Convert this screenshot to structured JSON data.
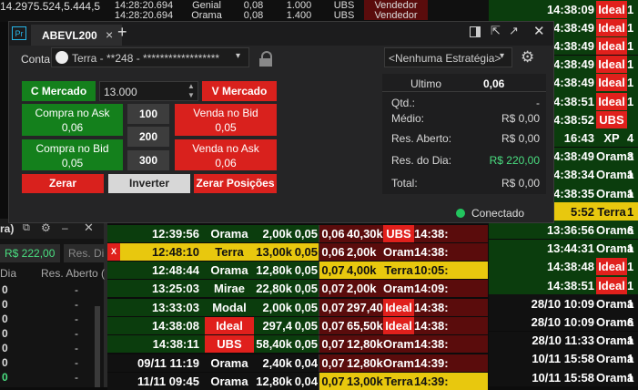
{
  "background": {
    "ticker_line": "14.2975.524,5.444,5",
    "top_trades": [
      {
        "time": "14:28:20.694",
        "buyer": "Genial",
        "price": "0,08",
        "qty": "1.000",
        "seller": "UBS",
        "side": "Vendedor"
      },
      {
        "time": "14:28:20.694",
        "buyer": "Orama",
        "price": "0,08",
        "qty": "1.400",
        "seller": "UBS",
        "side": "Vendedor"
      }
    ],
    "right_ladder": [
      {
        "time": "14:38:09",
        "broker": "Ideal",
        "extra": "1",
        "row": "green",
        "badge": "red"
      },
      {
        "time": "14:38:49",
        "broker": "Ideal",
        "extra": "1",
        "row": "green",
        "badge": "red"
      },
      {
        "time": "14:38:49",
        "broker": "Ideal",
        "extra": "1",
        "row": "green",
        "badge": "red"
      },
      {
        "time": "14:38:49",
        "broker": "Ideal",
        "extra": "1",
        "row": "green",
        "badge": "red"
      },
      {
        "time": "14:38:49",
        "broker": "Ideal",
        "extra": "1",
        "row": "green",
        "badge": "red"
      },
      {
        "time": "14:38:51",
        "broker": "Ideal",
        "extra": "1",
        "row": "green",
        "badge": "red"
      },
      {
        "time": "14:38:52",
        "broker": "UBS",
        "extra": "",
        "row": "green",
        "badge": "red"
      },
      {
        "time": "16:43",
        "broker": "XP",
        "extra": "4",
        "row": "green",
        "badge": "none"
      },
      {
        "time": "14:38:49",
        "broker": "Orama",
        "extra": "3",
        "row": "green",
        "badge": "none"
      },
      {
        "time": "14:38:34",
        "broker": "Orama",
        "extra": "1",
        "row": "green",
        "badge": "none"
      },
      {
        "time": "14:38:35",
        "broker": "Orama",
        "extra": "1",
        "row": "green",
        "badge": "none"
      },
      {
        "time": "5:52",
        "broker": "Terra",
        "extra": "1",
        "row": "yellow",
        "badge": "none"
      },
      {
        "time": "13:36:56",
        "broker": "Orama",
        "extra": "6",
        "row": "green",
        "badge": "none"
      },
      {
        "time": "13:44:31",
        "broker": "Orama",
        "extra": "1",
        "row": "green",
        "badge": "none"
      },
      {
        "time": "14:38:48",
        "broker": "Ideal",
        "extra": "1",
        "row": "green",
        "badge": "red"
      },
      {
        "time": "14:38:51",
        "broker": "Ideal",
        "extra": "1",
        "row": "green",
        "badge": "red"
      },
      {
        "time": "28/10 10:09",
        "broker": "Orama",
        "extra": "1",
        "row": "black",
        "badge": "none"
      },
      {
        "time": "28/10 10:09",
        "broker": "Orama",
        "extra": "6",
        "row": "black",
        "badge": "none"
      },
      {
        "time": "28/10 11:33",
        "broker": "Orama",
        "extra": "1",
        "row": "black",
        "badge": "none"
      },
      {
        "time": "10/11 15:58",
        "broker": "Orama",
        "extra": "1",
        "row": "black",
        "badge": "none"
      },
      {
        "time": "10/11 15:58",
        "broker": "Orama",
        "extra": "1",
        "row": "black",
        "badge": "none"
      }
    ],
    "bottom_rows": [
      {
        "x": "",
        "time": "12:39:56",
        "broker": "Orama",
        "qty": "2,00k",
        "p1": "0,05",
        "p2": "0,06",
        "q2": "40,30k",
        "b2": "UBS",
        "t2": "14:38:",
        "left": "green",
        "right": "darkred",
        "badge": "red"
      },
      {
        "x": "X",
        "time": "12:48:10",
        "broker": "Terra",
        "qty": "13,00k",
        "p1": "0,05",
        "p2": "0,06",
        "q2": "2,00k",
        "b2": "Orama",
        "t2": "14:38:",
        "left": "yellow",
        "right": "darkred",
        "badge": "none"
      },
      {
        "x": "",
        "time": "12:48:44",
        "broker": "Orama",
        "qty": "12,80k",
        "p1": "0,05",
        "p2": "0,07",
        "q2": "4,00k",
        "b2": "Terra",
        "t2": "10:05:",
        "left": "green",
        "right": "yellow",
        "badge": "none"
      },
      {
        "x": "",
        "time": "13:25:03",
        "broker": "Mirae",
        "qty": "22,80k",
        "p1": "0,05",
        "p2": "0,07",
        "q2": "2,00k",
        "b2": "Orama",
        "t2": "14:09:",
        "left": "green",
        "right": "darkred",
        "badge": "none"
      },
      {
        "x": "",
        "time": "13:33:03",
        "broker": "Modal",
        "qty": "2,00k",
        "p1": "0,05",
        "p2": "0,07",
        "q2": "297,40",
        "b2": "Ideal",
        "t2": "14:38:",
        "left": "green",
        "right": "darkred",
        "badge": "red"
      },
      {
        "x": "",
        "time": "14:38:08",
        "broker": "Ideal",
        "qty": "297,4",
        "p1": "0,05",
        "p2": "0,07",
        "q2": "65,50k",
        "b2": "Ideal",
        "t2": "14:38:",
        "left": "green",
        "right": "darkred",
        "badge": "red"
      },
      {
        "x": "",
        "time": "14:38:11",
        "broker": "UBS",
        "qty": "58,40k",
        "p1": "0,05",
        "p2": "0,07",
        "q2": "12,80k",
        "b2": "Orama",
        "t2": "14:38:",
        "left": "green",
        "right": "darkred",
        "badge": "none"
      },
      {
        "x": "",
        "time": "09/11 11:19",
        "broker": "Orama",
        "qty": "2,40k",
        "p1": "0,04",
        "p2": "0,07",
        "q2": "12,80k",
        "b2": "Orama",
        "t2": "14:39:",
        "left": "black",
        "right": "darkred",
        "badge": "none"
      },
      {
        "x": "",
        "time": "11/11 09:45",
        "broker": "Orama",
        "qty": "12,80k",
        "p1": "0,04",
        "p2": "0,07",
        "q2": "13,00k",
        "b2": "Terra",
        "t2": "14:39:",
        "left": "black",
        "right": "yellow",
        "badge": "none"
      }
    ],
    "left_panel": {
      "title": "ra)",
      "value_chip": "R$ 222,00",
      "res_label": "Res. Di",
      "col1": "Dia",
      "col2": "Res. Aberto (",
      "rows": [
        "0",
        "0",
        "0",
        "0",
        "0",
        "0",
        "0"
      ],
      "dashes": [
        "-",
        "-",
        "-",
        "-",
        "-",
        "-",
        "-"
      ]
    }
  },
  "window": {
    "app_icon": "Pr",
    "tab_label": "ABEVL200",
    "close_tab": "×",
    "add_tab": "+",
    "conta_label": "Conta",
    "account_value": "Terra - **248 - ******************",
    "strategy_value": "<Nenhuma Estratégia>",
    "buttons": {
      "c_mercado": "C Mercado",
      "v_mercado": "V Mercado",
      "quantity": "13.000",
      "compra_ask_label": "Compra no Ask",
      "compra_ask_price": "0,06",
      "venda_bid_label": "Venda no Bid",
      "venda_bid_price": "0,05",
      "compra_bid_label": "Compra no Bid",
      "compra_bid_price": "0,05",
      "venda_ask_label": "Venda no Ask",
      "venda_ask_price": "0,06",
      "q100": "100",
      "q200": "200",
      "q300": "300",
      "zerar": "Zerar",
      "inverter": "Inverter",
      "zerar_posicoes": "Zerar Posições"
    },
    "stats": {
      "ultimo_label": "Ultimo",
      "ultimo_value": "0,06",
      "qtd_label": "Qtd.:",
      "qtd_value": "-",
      "medio_label": "Médio:",
      "medio_value": "R$ 0,00",
      "res_aberto_label": "Res. Aberto:",
      "res_aberto_value": "R$ 0,00",
      "res_dia_label": "Res. do Dia:",
      "res_dia_value": "R$ 220,00",
      "total_label": "Total:",
      "total_value": "R$ 0,00"
    },
    "status": "Conectado",
    "colors": {
      "red": "#d9211d",
      "green": "#14801c",
      "connected": "#22c55e",
      "profit": "#4ade80"
    }
  }
}
